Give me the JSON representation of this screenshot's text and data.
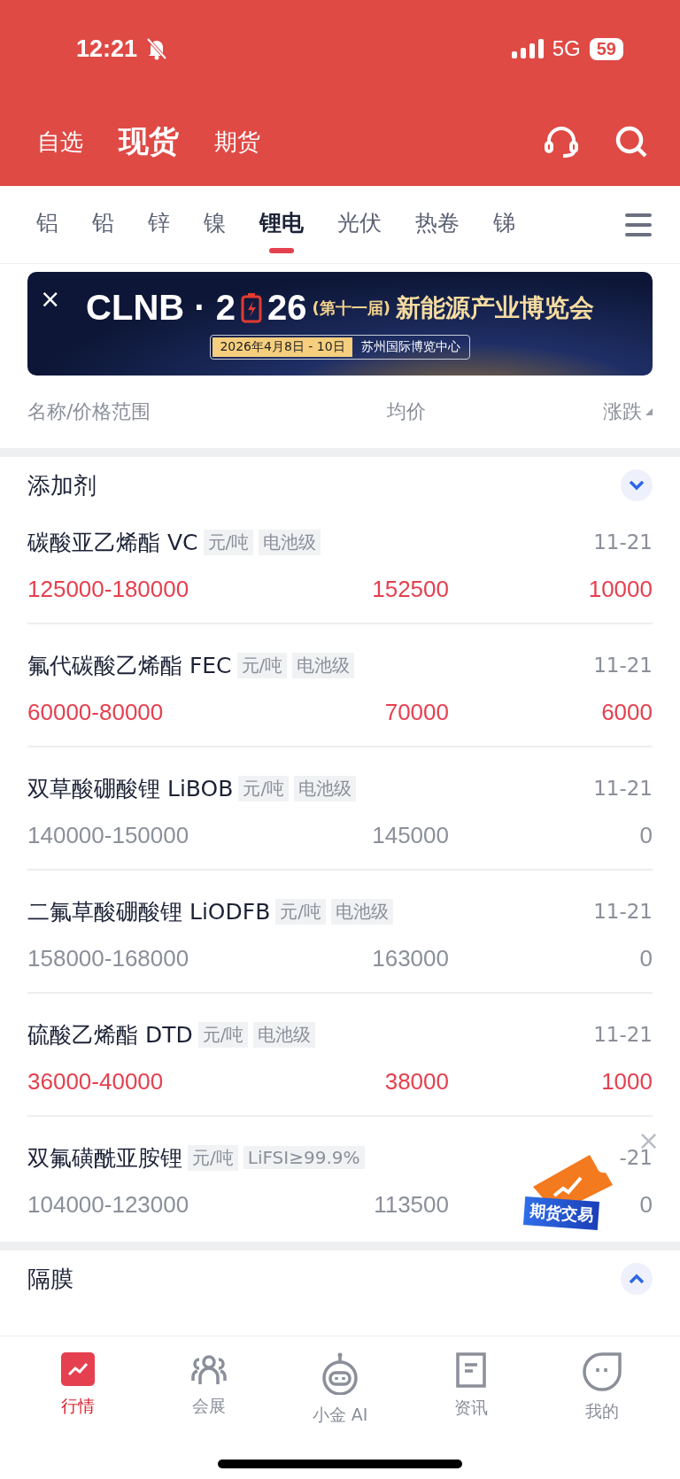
{
  "status_bar": {
    "time": "12:21",
    "network": "5G",
    "battery": "59"
  },
  "top_tabs": [
    {
      "label": "自选",
      "selected": false
    },
    {
      "label": "现货",
      "selected": true
    },
    {
      "label": "期货",
      "selected": false
    }
  ],
  "category_tabs": [
    {
      "label": "铝",
      "selected": false
    },
    {
      "label": "铅",
      "selected": false
    },
    {
      "label": "锌",
      "selected": false
    },
    {
      "label": "镍",
      "selected": false
    },
    {
      "label": "锂电",
      "selected": true
    },
    {
      "label": "光伏",
      "selected": false
    },
    {
      "label": "热卷",
      "selected": false
    },
    {
      "label": "锑",
      "selected": false
    }
  ],
  "banner": {
    "close": "×",
    "logo_before": "CLNB · 2",
    "logo_after": "26",
    "edition": "(第十一届)",
    "title": "新能源产业博览会",
    "date": "2026年4月8日 - 10日",
    "venue": "苏州国际博览中心"
  },
  "columns": [
    "名称/价格范围",
    "均价",
    "涨跌"
  ],
  "sections": [
    {
      "title": "添加剂",
      "expanded": true,
      "rows": [
        {
          "name": "碳酸亚乙烯酯 VC",
          "unit": "元/吨",
          "grade": "电池级",
          "date": "11-21",
          "range": "125000-180000",
          "avg": "152500",
          "change": "10000",
          "color": "#e5404f"
        },
        {
          "name": "氟代碳酸乙烯酯 FEC",
          "unit": "元/吨",
          "grade": "电池级",
          "date": "11-21",
          "range": "60000-80000",
          "avg": "70000",
          "change": "6000",
          "color": "#e5404f"
        },
        {
          "name": "双草酸硼酸锂 LiBOB",
          "unit": "元/吨",
          "grade": "电池级",
          "date": "11-21",
          "range": "140000-150000",
          "avg": "145000",
          "change": "0",
          "color": "#8a8f99"
        },
        {
          "name": "二氟草酸硼酸锂 LiODFB",
          "unit": "元/吨",
          "grade": "电池级",
          "date": "11-21",
          "range": "158000-168000",
          "avg": "163000",
          "change": "0",
          "color": "#8a8f99"
        },
        {
          "name": "硫酸乙烯酯 DTD",
          "unit": "元/吨",
          "grade": "电池级",
          "date": "11-21",
          "range": "36000-40000",
          "avg": "38000",
          "change": "1000",
          "color": "#e5404f"
        },
        {
          "name": "双氟磺酰亚胺锂",
          "unit": "元/吨",
          "grade": "LiFSI≥99.9%",
          "date": "-21",
          "range": "104000-123000",
          "avg": "113500",
          "change": "0",
          "color": "#8a8f99"
        }
      ]
    },
    {
      "title": "隔膜",
      "expanded": false
    }
  ],
  "float_badge": {
    "close": "×",
    "label": "期货交易"
  },
  "bottom_tabs": [
    {
      "label": "行情",
      "selected": true
    },
    {
      "label": "会展",
      "selected": false
    },
    {
      "label": "小金 AI",
      "selected": false
    },
    {
      "label": "资讯",
      "selected": false
    },
    {
      "label": "我的",
      "selected": false
    }
  ]
}
